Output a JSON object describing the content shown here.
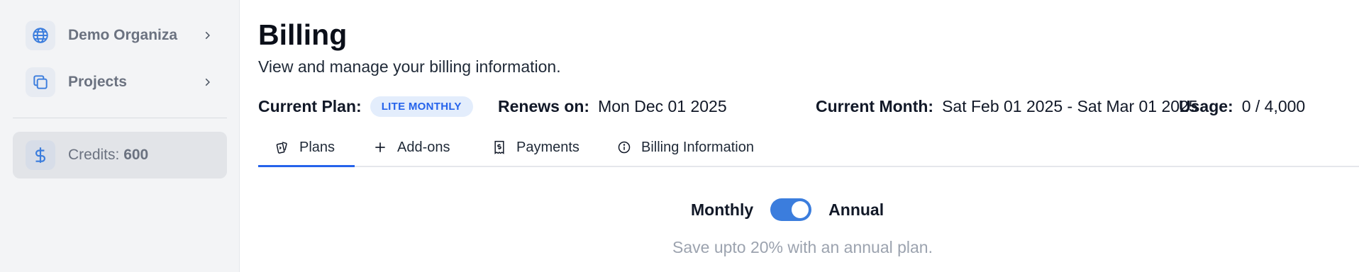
{
  "sidebar": {
    "org": {
      "label": "Demo Organiza",
      "icon": "globe-icon"
    },
    "projects": {
      "label": "Projects",
      "icon": "copy-icon"
    },
    "credits": {
      "label": "Credits:",
      "value": "600",
      "icon": "dollar-icon"
    }
  },
  "header": {
    "title": "Billing",
    "subtitle": "View and manage your billing information."
  },
  "plan_info": {
    "current_plan_label": "Current Plan:",
    "current_plan_value": "LITE MONTHLY",
    "renews_label": "Renews on:",
    "renews_value": "Mon Dec 01 2025",
    "current_month_label": "Current Month:",
    "current_month_value": "Sat Feb 01 2025 - Sat Mar 01 2025",
    "usage_label": "Usage:",
    "usage_value": "0 / 4,000"
  },
  "tabs": [
    {
      "label": "Plans",
      "icon": "cards-icon",
      "active": true
    },
    {
      "label": "Add-ons",
      "icon": "plus-icon",
      "active": false
    },
    {
      "label": "Payments",
      "icon": "receipt-icon",
      "active": false
    },
    {
      "label": "Billing Information",
      "icon": "info-icon",
      "active": false
    }
  ],
  "billing_toggle": {
    "left_label": "Monthly",
    "right_label": "Annual",
    "state": "annual",
    "note": "Save upto 20% with an annual plan."
  },
  "colors": {
    "accent": "#2563eb",
    "switch": "#3b7ddd",
    "badge_bg": "#e3edfc",
    "sidebar_bg": "#f3f4f6"
  }
}
